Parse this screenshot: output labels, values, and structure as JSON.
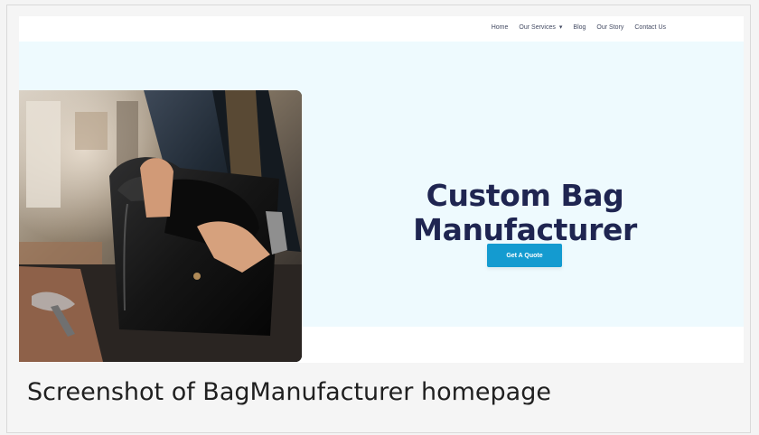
{
  "navigation": {
    "items": [
      {
        "label": "Home"
      },
      {
        "label": "Our Services",
        "icon": "dropdown-caret-icon"
      },
      {
        "label": "Blog"
      },
      {
        "label": "Our Story"
      },
      {
        "label": "Contact Us"
      }
    ]
  },
  "hero": {
    "title_line_1": "Custom Bag",
    "title_line_2": "Manufacturer",
    "button_label": "Get A Quote",
    "image": "craftsman-stitching-leather-bag-photo"
  },
  "caption": "Screenshot of BagManufacturer homepage",
  "colors": {
    "hero_background": "#eefafe",
    "title": "#1f2551",
    "button": "#149bd0",
    "nav_text": "#444b63"
  }
}
